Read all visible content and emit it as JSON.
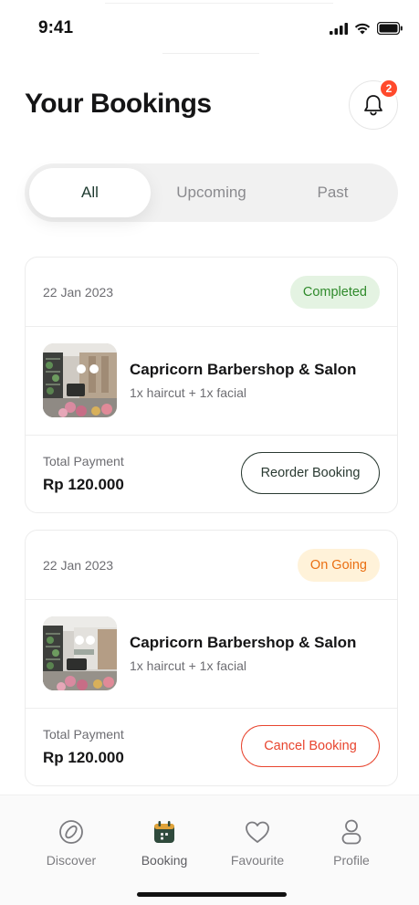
{
  "status_bar": {
    "time": "9:41"
  },
  "header": {
    "title": "Your Bookings",
    "notification_count": "2"
  },
  "tabs": [
    {
      "label": "All",
      "active": true
    },
    {
      "label": "Upcoming",
      "active": false
    },
    {
      "label": "Past",
      "active": false
    }
  ],
  "bookings": [
    {
      "date": "22 Jan 2023",
      "status": "Completed",
      "salon_name": "Capricorn Barbershop & Salon",
      "services": "1x haircut + 1x facial",
      "payment_label": "Total Payment",
      "payment_value": "Rp 120.000",
      "action_label": "Reorder Booking"
    },
    {
      "date": "22 Jan 2023",
      "status": "On Going",
      "salon_name": "Capricorn Barbershop & Salon",
      "services": "1x haircut + 1x facial",
      "payment_label": "Total Payment",
      "payment_value": "Rp 120.000",
      "action_label": "Cancel Booking"
    }
  ],
  "bottom_nav": [
    {
      "label": "Discover",
      "icon": "compass-icon",
      "active": false
    },
    {
      "label": "Booking",
      "icon": "calendar-icon",
      "active": true
    },
    {
      "label": "Favourite",
      "icon": "heart-icon",
      "active": false
    },
    {
      "label": "Profile",
      "icon": "person-icon",
      "active": false
    }
  ],
  "colors": {
    "accent_dark_green": "#2f4a3c",
    "completed_green": "#2f8a2b",
    "ongoing_orange": "#ea6f12",
    "cancel_red": "#e8452f",
    "badge_red": "#ff4a2c"
  }
}
